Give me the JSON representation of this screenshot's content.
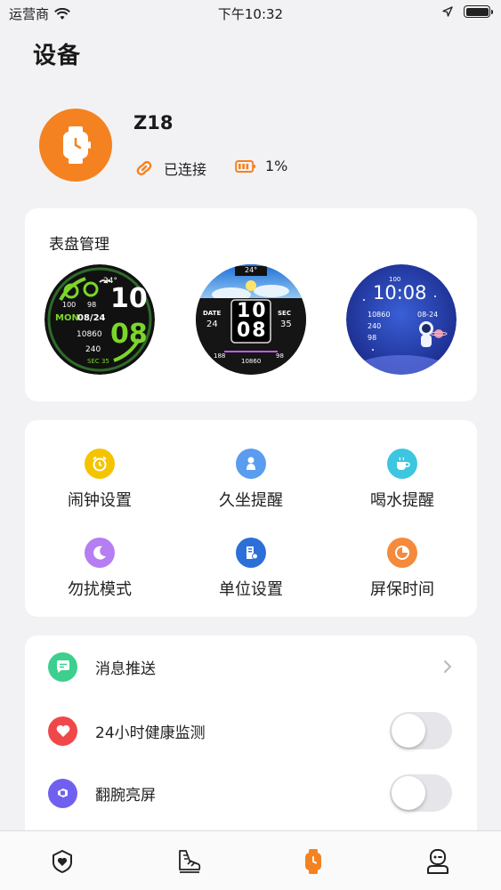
{
  "status_bar": {
    "carrier": "运营商",
    "time": "下午10:32"
  },
  "page": {
    "title": "设备"
  },
  "device": {
    "name": "Z18",
    "connection": "已连接",
    "battery": "1%"
  },
  "watch_faces": {
    "title": "表盘管理",
    "faces": [
      {
        "hour": "10",
        "minute": "08",
        "day": "MON",
        "date": "08/24",
        "steps": "10860",
        "calories": "240",
        "seconds": "SEC 35",
        "hr": "98",
        "o2": "100",
        "temp": "24°"
      },
      {
        "hour": "10",
        "minute": "08",
        "date_label": "DATE",
        "date": "24",
        "sec_label": "SEC",
        "sec": "35",
        "temp": "24°",
        "left_val": "188",
        "steps": "10860",
        "right_val": "98"
      },
      {
        "time": "10:08",
        "date": "08-24",
        "steps": "10860",
        "calories": "240",
        "hr": "98",
        "battery": "100"
      }
    ]
  },
  "functions": [
    {
      "label": "闹钟设置",
      "icon": "alarm-clock-icon",
      "color": "#f5c400"
    },
    {
      "label": "久坐提醒",
      "icon": "sitting-person-icon",
      "color": "#5a9cf0"
    },
    {
      "label": "喝水提醒",
      "icon": "coffee-cup-icon",
      "color": "#3cc6e0"
    },
    {
      "label": "勿扰模式",
      "icon": "moon-icon",
      "color": "#b57ef2"
    },
    {
      "label": "单位设置",
      "icon": "unit-building-icon",
      "color": "#2d6fd8"
    },
    {
      "label": "屏保时间",
      "icon": "pie-timer-icon",
      "color": "#f58a3c"
    }
  ],
  "settings": [
    {
      "label": "消息推送",
      "icon": "message-icon",
      "color": "#3ccf8e",
      "control": "chevron"
    },
    {
      "label": "24小时健康监测",
      "icon": "heart-icon",
      "color": "#f0484a",
      "control": "toggle",
      "on": false
    },
    {
      "label": "翻腕亮屏",
      "icon": "wrist-icon",
      "color": "#7060f0",
      "control": "toggle",
      "on": false
    }
  ],
  "tabs": [
    {
      "name": "health",
      "icon": "heart-shield-icon",
      "active": false
    },
    {
      "name": "sport",
      "icon": "shoe-icon",
      "active": false
    },
    {
      "name": "device",
      "icon": "watch-icon",
      "active": true
    },
    {
      "name": "mine",
      "icon": "profile-icon",
      "active": false
    }
  ],
  "colors": {
    "accent": "#f58220",
    "background": "#f2f2f4",
    "card": "#ffffff"
  }
}
